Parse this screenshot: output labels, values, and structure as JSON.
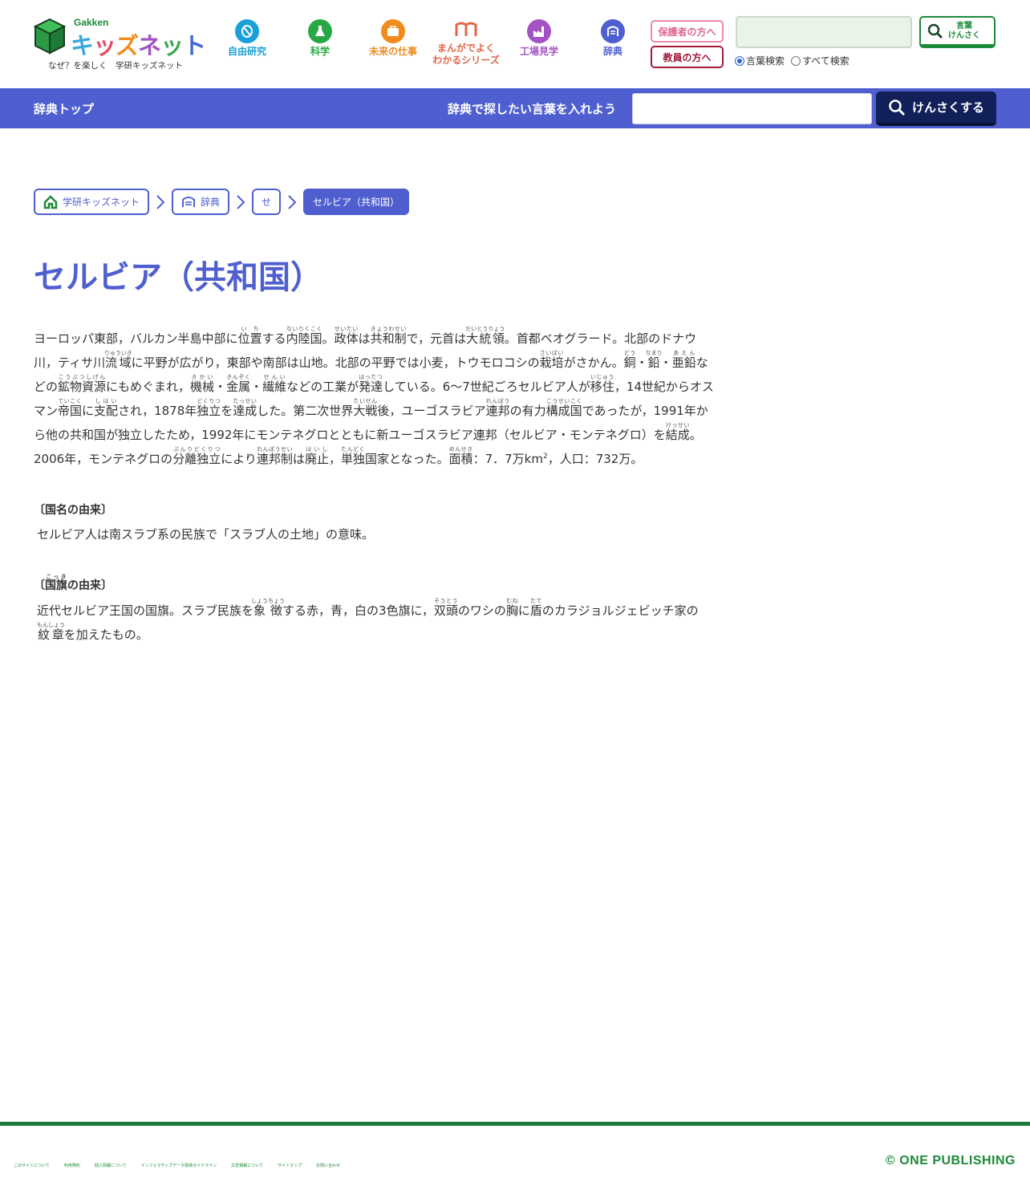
{
  "header": {
    "logo_brand": "Gakken",
    "logo_name_chars": [
      "キ",
      "ッ",
      "ズ",
      "ネ",
      "ッ",
      "ト"
    ],
    "tagline": "なぜ？を楽しく　学研キッズネット",
    "nav": [
      {
        "label": "自由研究",
        "color": "#1aa0d8",
        "icon": "research-icon"
      },
      {
        "label": "科学",
        "color": "#27a845",
        "icon": "flask-icon"
      },
      {
        "label": "未来の仕事",
        "color": "#f08c1e",
        "icon": "briefcase-icon"
      },
      {
        "label": "まんがでよく",
        "label2": "わかるシリーズ",
        "color": "#e0684a",
        "icon": "book-open-icon"
      },
      {
        "label": "工場見学",
        "color": "#a353c4",
        "icon": "factory-icon"
      },
      {
        "label": "辞典",
        "color": "#4f5fd0",
        "icon": "dictionary-icon"
      }
    ],
    "parent_button": "保護者の方へ",
    "teacher_button": "教員の方へ",
    "search_value": "",
    "search_button_line1": "言葉",
    "search_button_line2": "けんさく",
    "radio_word": "言葉検索",
    "radio_all": "すべて検索",
    "radio_selected": "言葉検索"
  },
  "bar": {
    "home_link": "辞典トップ",
    "prompt": "辞典で探したい言葉を入れよう",
    "input_value": "",
    "search_button": "けんさくする"
  },
  "breadcrumb": {
    "items": [
      "学研キッズネット",
      "辞典",
      "せ"
    ],
    "current": "セルビア（共和国）"
  },
  "article": {
    "title": "セルビア（共和国）",
    "heading_name": "〔国名の由来〕",
    "name_text": "セルビア人は南スラブ系の民族で「スラブ人の土地」の意味。",
    "heading_flag_pre": "〔",
    "heading_flag_post": "の由来〕"
  },
  "footer": {
    "links": [
      "このサイトについて",
      "利用規約",
      "個人情報について",
      "インフォマティブデータ取得ガイドライン",
      "広告掲載について",
      "サイトマップ",
      "お問い合わせ"
    ],
    "copyright": "© ONE PUBLISHING"
  },
  "colors": {
    "brand_blue": "#4f5fd0",
    "brand_green": "#1d8a3a",
    "navy": "#12205a"
  }
}
